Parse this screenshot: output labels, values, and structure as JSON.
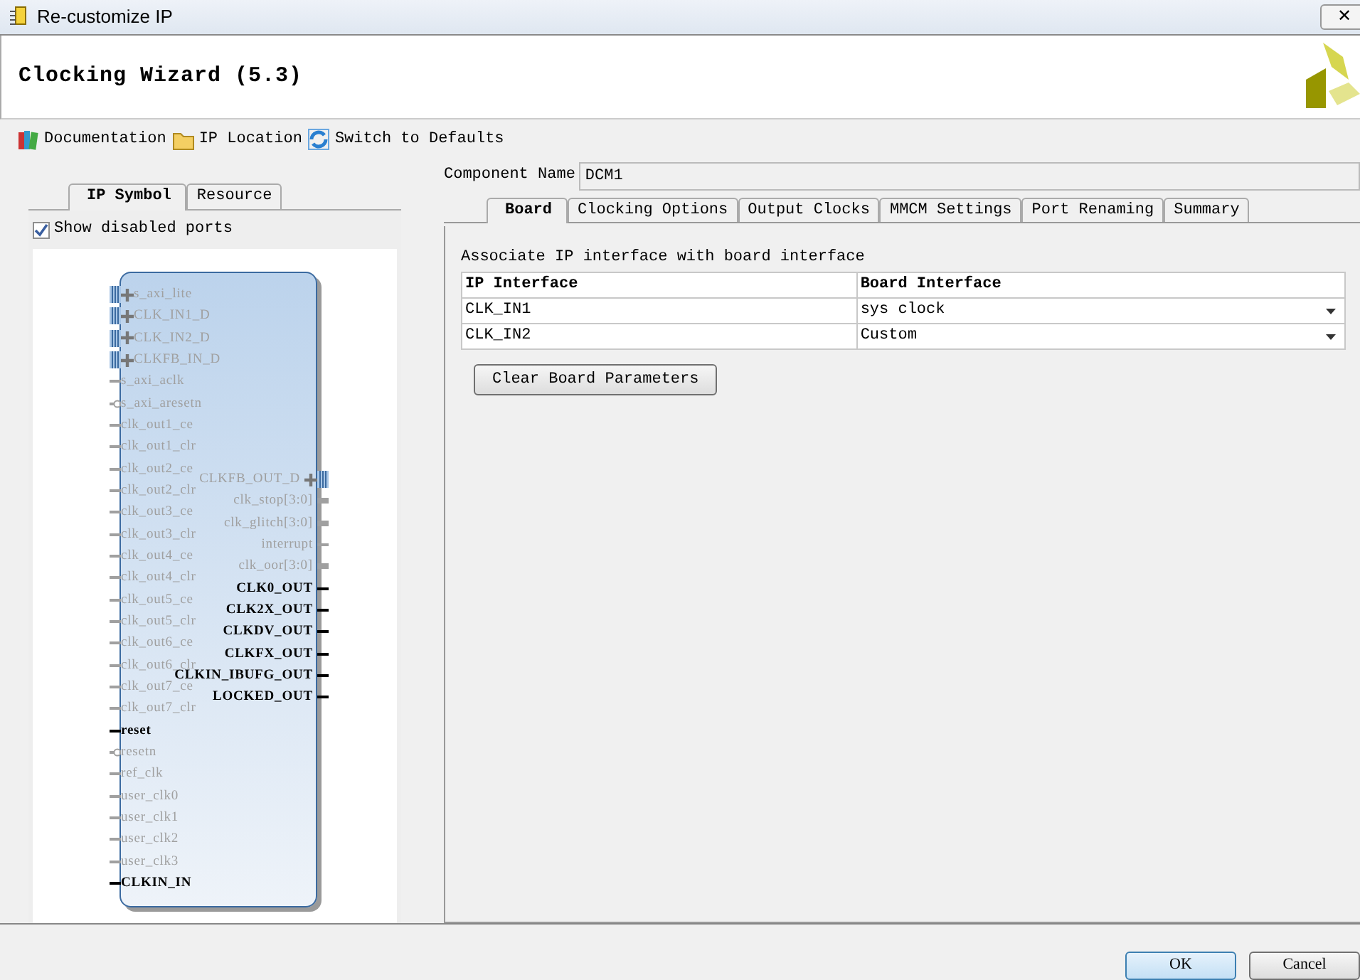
{
  "window": {
    "title": "Re-customize IP",
    "close_glyph": "✕"
  },
  "header": {
    "title": "Clocking Wizard (5.3)"
  },
  "toolbar": [
    {
      "label": "Documentation",
      "kind": "books"
    },
    {
      "label": "IP Location",
      "kind": "folder"
    },
    {
      "label": "Switch to Defaults",
      "kind": "refresh"
    }
  ],
  "left_tabs": [
    {
      "label": "IP Symbol",
      "selected": true
    },
    {
      "label": "Resource",
      "selected": false
    }
  ],
  "show_disabled_ports": {
    "label": "Show disabled ports",
    "checked": true
  },
  "symbol": {
    "left_ports": [
      {
        "label": "s_axi_lite",
        "kind": "bus",
        "enabled": false
      },
      {
        "label": "CLK_IN1_D",
        "kind": "bus",
        "enabled": false
      },
      {
        "label": "CLK_IN2_D",
        "kind": "bus",
        "enabled": false
      },
      {
        "label": "CLKFB_IN_D",
        "kind": "bus",
        "enabled": false
      },
      {
        "label": "s_axi_aclk",
        "kind": "wire",
        "enabled": false
      },
      {
        "label": "s_axi_aresetn",
        "kind": "inverted",
        "enabled": false
      },
      {
        "label": "clk_out1_ce",
        "kind": "wire",
        "enabled": false
      },
      {
        "label": "clk_out1_clr",
        "kind": "wire",
        "enabled": false
      },
      {
        "label": "clk_out2_ce",
        "kind": "wire",
        "enabled": false
      },
      {
        "label": "clk_out2_clr",
        "kind": "wire",
        "enabled": false
      },
      {
        "label": "clk_out3_ce",
        "kind": "wire",
        "enabled": false
      },
      {
        "label": "clk_out3_clr",
        "kind": "wire",
        "enabled": false
      },
      {
        "label": "clk_out4_ce",
        "kind": "wire",
        "enabled": false
      },
      {
        "label": "clk_out4_clr",
        "kind": "wire",
        "enabled": false
      },
      {
        "label": "clk_out5_ce",
        "kind": "wire",
        "enabled": false
      },
      {
        "label": "clk_out5_clr",
        "kind": "wire",
        "enabled": false
      },
      {
        "label": "clk_out6_ce",
        "kind": "wire",
        "enabled": false
      },
      {
        "label": "clk_out6_clr",
        "kind": "wire",
        "enabled": false
      },
      {
        "label": "clk_out7_ce",
        "kind": "wire",
        "enabled": false
      },
      {
        "label": "clk_out7_clr",
        "kind": "wire",
        "enabled": false
      },
      {
        "label": "reset",
        "kind": "wire",
        "enabled": true
      },
      {
        "label": "resetn",
        "kind": "inverted",
        "enabled": false
      },
      {
        "label": "ref_clk",
        "kind": "wire",
        "enabled": false
      },
      {
        "label": "user_clk0",
        "kind": "wire",
        "enabled": false
      },
      {
        "label": "user_clk1",
        "kind": "wire",
        "enabled": false
      },
      {
        "label": "user_clk2",
        "kind": "wire",
        "enabled": false
      },
      {
        "label": "user_clk3",
        "kind": "wire",
        "enabled": false
      },
      {
        "label": "CLKIN_IN",
        "kind": "wire",
        "enabled": true
      }
    ],
    "right_ports": [
      {
        "label": "CLKFB_OUT_D",
        "kind": "bus",
        "enabled": false
      },
      {
        "label": "clk_stop[3:0]",
        "kind": "vector",
        "enabled": false
      },
      {
        "label": "clk_glitch[3:0]",
        "kind": "vector",
        "enabled": false
      },
      {
        "label": "interrupt",
        "kind": "wire",
        "enabled": false
      },
      {
        "label": "clk_oor[3:0]",
        "kind": "vector",
        "enabled": false
      },
      {
        "label": "CLK0_OUT",
        "kind": "wire",
        "enabled": true
      },
      {
        "label": "CLK2X_OUT",
        "kind": "wire",
        "enabled": true
      },
      {
        "label": "CLKDV_OUT",
        "kind": "wire",
        "enabled": true
      },
      {
        "label": "CLKFX_OUT",
        "kind": "wire",
        "enabled": true
      },
      {
        "label": "CLKIN_IBUFG_OUT",
        "kind": "wire",
        "enabled": true
      },
      {
        "label": "LOCKED_OUT",
        "kind": "wire",
        "enabled": true
      }
    ]
  },
  "component_name": {
    "label": "Component Name",
    "value": "DCM1"
  },
  "tabs": [
    {
      "label": "Board",
      "selected": true
    },
    {
      "label": "Clocking Options",
      "selected": false
    },
    {
      "label": "Output Clocks",
      "selected": false
    },
    {
      "label": "MMCM Settings",
      "selected": false
    },
    {
      "label": "Port Renaming",
      "selected": false
    },
    {
      "label": "Summary",
      "selected": false
    }
  ],
  "board": {
    "caption": "Associate IP interface with board interface",
    "columns": [
      "IP Interface",
      "Board Interface"
    ],
    "rows": [
      {
        "ip_interface": "CLK_IN1",
        "board_interface": "sys clock"
      },
      {
        "ip_interface": "CLK_IN2",
        "board_interface": "Custom"
      }
    ],
    "clear_button": "Clear Board Parameters"
  },
  "buttons": [
    {
      "label": "OK",
      "default": true
    },
    {
      "label": "Cancel",
      "default": false
    }
  ]
}
